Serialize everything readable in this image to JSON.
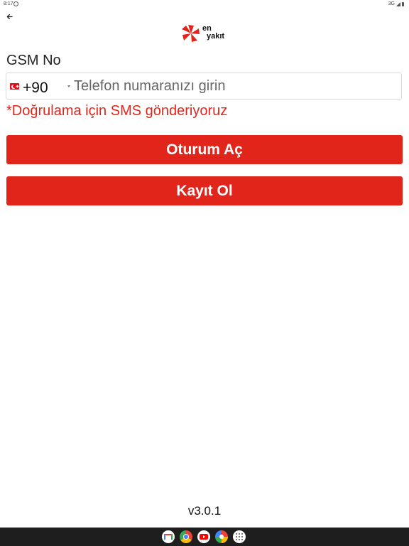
{
  "status_bar": {
    "time": "8:17",
    "network": "3G"
  },
  "header": {
    "logo": {
      "line1": "en",
      "line2": "yakıt",
      "brand_color": "#e1251b"
    }
  },
  "form": {
    "gsm_label": "GSM No",
    "phone": {
      "country_flag": "turkey-flag-icon",
      "dial_code": "+90",
      "placeholder": "Telefon numaranızı girin",
      "value": ""
    },
    "sms_note": "*Doğrulama için SMS gönderiyoruz"
  },
  "actions": {
    "login_label": "Oturum Aç",
    "register_label": "Kayıt Ol",
    "button_color": "#e1251b"
  },
  "footer": {
    "version": "v3.0.1"
  },
  "dock": {
    "apps": [
      "gmail-icon",
      "chrome-icon",
      "youtube-icon",
      "photos-icon",
      "app-drawer-icon"
    ]
  }
}
